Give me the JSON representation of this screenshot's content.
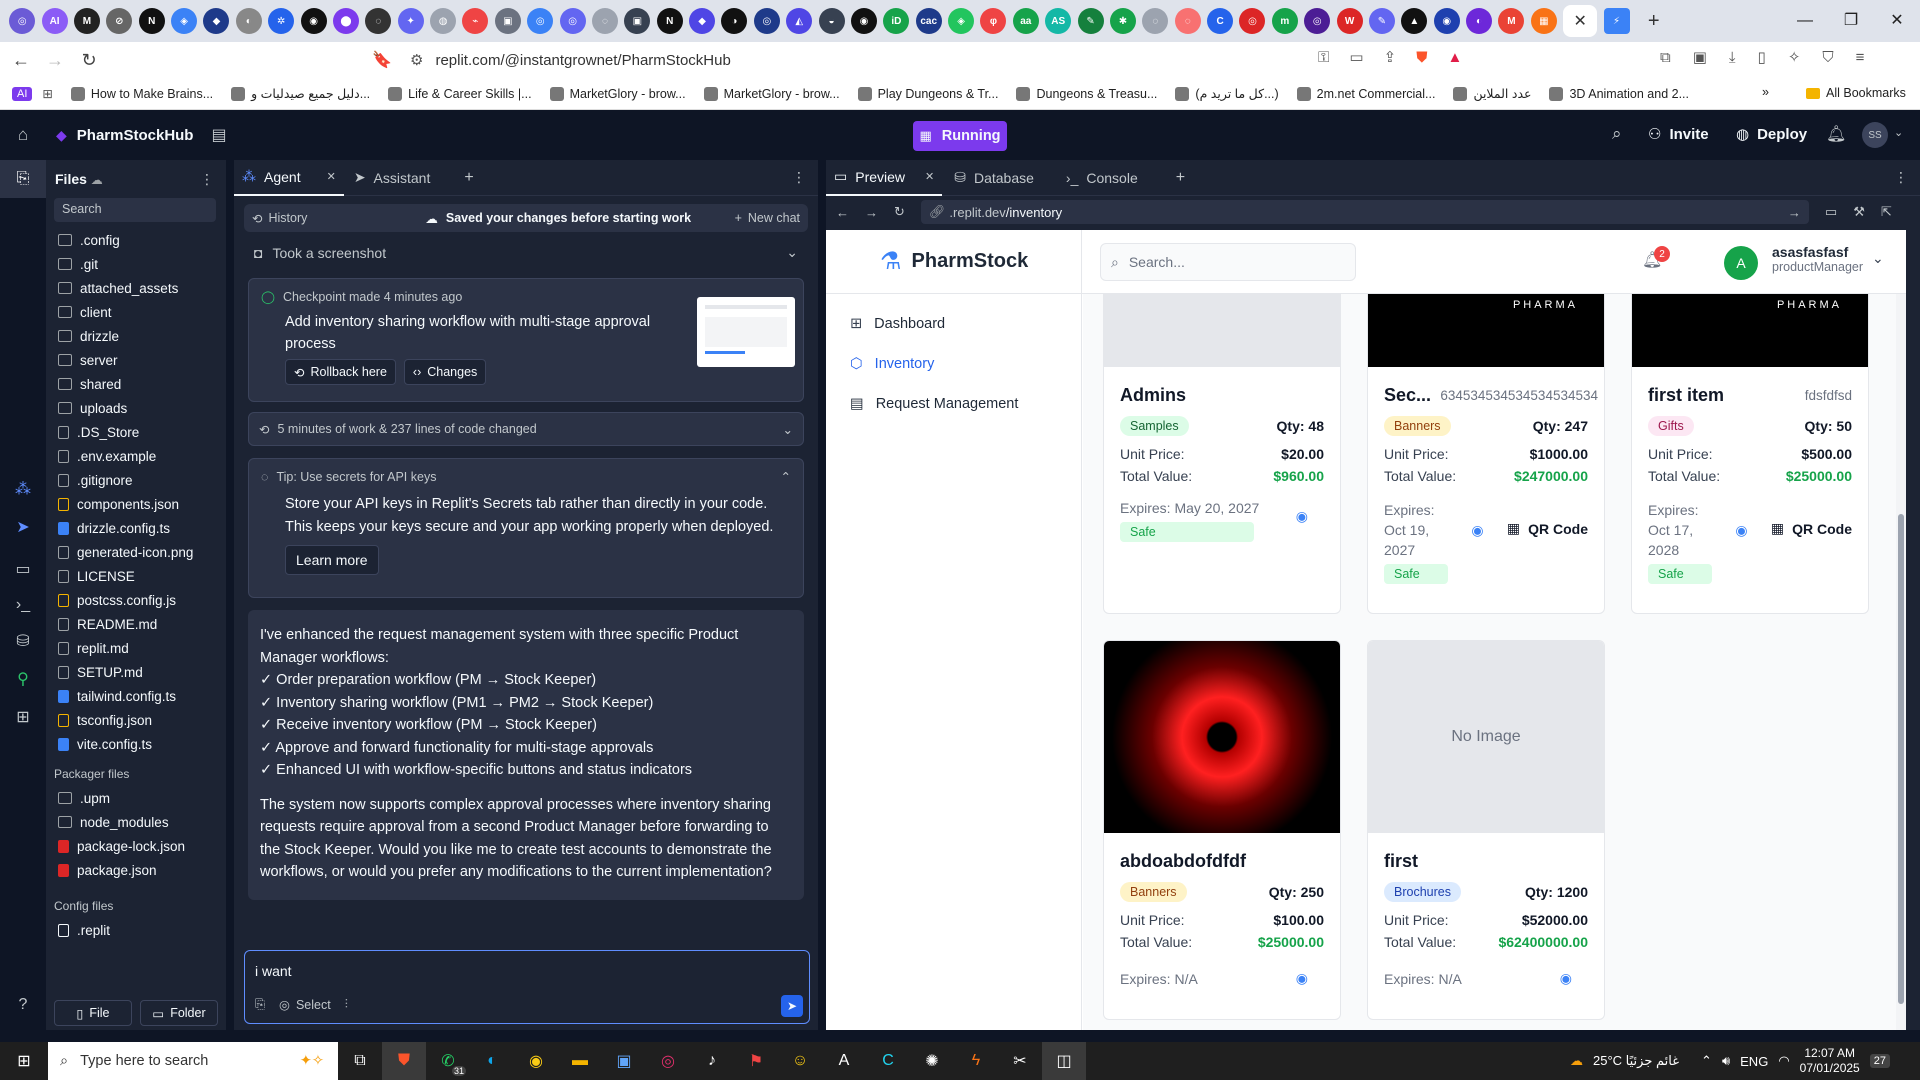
{
  "browser": {
    "favicon_tabs": [
      {
        "label": "◎",
        "color": "#6b5bd6"
      },
      {
        "label": "AI",
        "color": "#8b5cf6"
      },
      {
        "label": "M",
        "color": "#222"
      },
      {
        "label": "⊘",
        "color": "#666"
      },
      {
        "label": "N",
        "color": "#111"
      },
      {
        "label": "◈",
        "color": "#3b82f6"
      },
      {
        "label": "◆",
        "color": "#1e3a8a"
      },
      {
        "label": "◐",
        "color": "#888"
      },
      {
        "label": "✲",
        "color": "#2563eb"
      },
      {
        "label": "◉",
        "color": "#111"
      },
      {
        "label": "⬤",
        "color": "#7c3aed"
      },
      {
        "label": "◌",
        "color": "#333"
      },
      {
        "label": "✦",
        "color": "#6366f1"
      },
      {
        "label": "◍",
        "color": "#9ca3af"
      },
      {
        "label": "⌁",
        "color": "#ef4444"
      },
      {
        "label": "▣",
        "color": "#6b7280"
      },
      {
        "label": "◎",
        "color": "#3b82f6"
      },
      {
        "label": "◎",
        "color": "#6366f1"
      },
      {
        "label": "◌",
        "color": "#9ca3af"
      },
      {
        "label": "▣",
        "color": "#374151"
      },
      {
        "label": "N",
        "color": "#111"
      },
      {
        "label": "◆",
        "color": "#4f46e5"
      },
      {
        "label": "◑",
        "color": "#111"
      },
      {
        "label": "◎",
        "color": "#1e3a8a"
      },
      {
        "label": "◭",
        "color": "#4f46e5"
      },
      {
        "label": "◒",
        "color": "#374151"
      },
      {
        "label": "◉",
        "color": "#111"
      },
      {
        "label": "iD",
        "color": "#16a34a"
      },
      {
        "label": "cac",
        "color": "#1e3a8a"
      },
      {
        "label": "◈",
        "color": "#22c55e"
      },
      {
        "label": "φ",
        "color": "#ef4444"
      },
      {
        "label": "aa",
        "color": "#16a34a"
      },
      {
        "label": "AS",
        "color": "#14b8a6"
      },
      {
        "label": "✎",
        "color": "#15803d"
      },
      {
        "label": "✱",
        "color": "#16a34a"
      },
      {
        "label": "◌",
        "color": "#9ca3af"
      },
      {
        "label": "◌",
        "color": "#f87171"
      },
      {
        "label": "C",
        "color": "#2563eb"
      },
      {
        "label": "◎",
        "color": "#dc2626"
      },
      {
        "label": "m",
        "color": "#16a34a"
      },
      {
        "label": "◎",
        "color": "#4c1d95"
      },
      {
        "label": "W",
        "color": "#dc2626"
      },
      {
        "label": "✎",
        "color": "#6366f1"
      },
      {
        "label": "▲",
        "color": "#111"
      },
      {
        "label": "◉",
        "color": "#1e40af"
      },
      {
        "label": "◐",
        "color": "#6d28d9"
      },
      {
        "label": "M",
        "color": "#ea4335"
      },
      {
        "label": "▦",
        "color": "#f97316"
      }
    ],
    "active_tab_close": "✕",
    "last_tab": "⚡",
    "new_tab": "+",
    "url": "replit.com/@instantgrownet/PharmStockHub",
    "bookmarks": [
      "How to Make Brains...",
      "دليل جميع صيدليات و...",
      "Life & Career Skills |...",
      "MarketGlory - brow...",
      "MarketGlory - brow...",
      "Play Dungeons & Tr...",
      "Dungeons & Treasu...",
      "(كل ما تريد م...)",
      "2m.net Commercial...",
      "عدد الملاين",
      "3D Animation and 2..."
    ],
    "all_bookmarks": "All Bookmarks",
    "ai_label": "AI"
  },
  "replit": {
    "project_name": "PharmStockHub",
    "running": "Running",
    "invite": "Invite",
    "deploy": "Deploy",
    "avatar": "SS"
  },
  "files": {
    "title": "Files",
    "search_placeholder": "Search",
    "items": [
      {
        "name": ".config",
        "type": "folder"
      },
      {
        "name": ".git",
        "type": "folder"
      },
      {
        "name": "attached_assets",
        "type": "folder"
      },
      {
        "name": "client",
        "type": "folder"
      },
      {
        "name": "drizzle",
        "type": "folder"
      },
      {
        "name": "server",
        "type": "folder"
      },
      {
        "name": "shared",
        "type": "folder"
      },
      {
        "name": "uploads",
        "type": "folder"
      },
      {
        "name": ".DS_Store",
        "type": "file"
      },
      {
        "name": ".env.example",
        "type": "file"
      },
      {
        "name": ".gitignore",
        "type": "file"
      },
      {
        "name": "components.json",
        "type": "json"
      },
      {
        "name": "drizzle.config.ts",
        "type": "ts"
      },
      {
        "name": "generated-icon.png",
        "type": "img"
      },
      {
        "name": "LICENSE",
        "type": "file"
      },
      {
        "name": "postcss.config.js",
        "type": "js"
      },
      {
        "name": "README.md",
        "type": "md"
      },
      {
        "name": "replit.md",
        "type": "md"
      },
      {
        "name": "SETUP.md",
        "type": "md"
      },
      {
        "name": "tailwind.config.ts",
        "type": "ts"
      },
      {
        "name": "tsconfig.json",
        "type": "json"
      },
      {
        "name": "vite.config.ts",
        "type": "ts"
      }
    ],
    "packager_title": "Packager files",
    "packager": [
      {
        "name": ".upm",
        "type": "folder"
      },
      {
        "name": "node_modules",
        "type": "folder"
      },
      {
        "name": "package-lock.json",
        "type": "npm"
      },
      {
        "name": "package.json",
        "type": "npm"
      }
    ],
    "config_title": "Config files",
    "config": [
      {
        "name": ".replit",
        "type": "replit"
      }
    ],
    "new_file": "File",
    "new_folder": "Folder"
  },
  "agent": {
    "tab_agent": "Agent",
    "tab_assistant": "Assistant",
    "history": "History",
    "saved": "Saved your changes before starting work",
    "new_chat": "New chat",
    "screenshot": "Took a screenshot",
    "checkpoint_meta": "Checkpoint made 4 minutes ago",
    "checkpoint_title": "Add inventory sharing workflow with multi-stage approval process",
    "rollback": "Rollback here",
    "changes": "Changes",
    "work_summary": "5 minutes of work & 237 lines of code changed",
    "tip_title": "Tip: Use secrets for API keys",
    "tip_body": "Store your API keys in Replit's Secrets tab rather than directly in your code. This keeps your keys secure and your app working properly when deployed.",
    "learn_more": "Learn more",
    "message_intro": "I've enhanced the request management system with three specific Product Manager workflows:",
    "message_points": [
      "✓ Order preparation workflow (PM → Stock Keeper)",
      "✓ Inventory sharing workflow (PM1 → PM2 → Stock Keeper)",
      "✓ Receive inventory workflow (PM → Stock Keeper)",
      "✓ Approve and forward functionality for multi-stage approvals",
      "✓ Enhanced UI with workflow-specific buttons and status indicators"
    ],
    "message_outro": "The system now supports complex approval processes where inventory sharing requests require approval from a second Product Manager before forwarding to the Stock Keeper. Would you like me to create test accounts to demonstrate the workflows, or would you prefer any modifications to the current implementation?",
    "input_value": "i want",
    "select": "Select"
  },
  "preview": {
    "tab_preview": "Preview",
    "tab_database": "Database",
    "tab_console": "Console",
    "url_prefix": ".replit.dev",
    "url_path": "/inventory"
  },
  "app": {
    "brand": "PharmStock",
    "search_placeholder": "Search...",
    "notif_count": "2",
    "user_initial": "A",
    "user_name": "asasfasfasf",
    "user_role": "productManager",
    "nav": [
      "Dashboard",
      "Inventory",
      "Request Management"
    ],
    "pharma_text": "PHARMA",
    "cards_top": [
      {
        "name": "Admins",
        "code": "",
        "category": "Samples",
        "qty": "Qty: 48",
        "unit_label": "Unit Price:",
        "unit": "$20.00",
        "total_label": "Total Value:",
        "total": "$960.00",
        "expires": "Expires: May 20, 2027",
        "status": "Safe",
        "qr": ""
      },
      {
        "name": "Sec...",
        "code": "634534534534534534534",
        "category": "Banners",
        "qty": "Qty: 247",
        "unit_label": "Unit Price:",
        "unit": "$1000.00",
        "total_label": "Total Value:",
        "total": "$247000.00",
        "expires": "Expires: Oct 19, 2027",
        "status": "Safe",
        "qr": "QR Code"
      },
      {
        "name": "first item",
        "code": "fdsfdfsd",
        "category": "Gifts",
        "qty": "Qty: 50",
        "unit_label": "Unit Price:",
        "unit": "$500.00",
        "total_label": "Total Value:",
        "total": "$25000.00",
        "expires": "Expires: Oct 17, 2028",
        "status": "Safe",
        "qr": "QR Code"
      }
    ],
    "cards_bottom": [
      {
        "name": "abdoabdofdfdf",
        "category": "Banners",
        "qty": "Qty: 250",
        "unit_label": "Unit Price:",
        "unit": "$100.00",
        "total_label": "Total Value:",
        "total": "$25000.00",
        "expires": "Expires: N/A"
      },
      {
        "name": "first",
        "category": "Brochures",
        "qty": "Qty: 1200",
        "unit_label": "Unit Price:",
        "unit": "$52000.00",
        "total_label": "Total Value:",
        "total": "$62400000.00",
        "expires": "Expires: N/A",
        "no_image": "No Image"
      }
    ]
  },
  "taskbar": {
    "search_placeholder": "Type here to search",
    "whatsapp_badge": "31",
    "weather": "25°C غائم جزئيًا",
    "lang": "ENG",
    "time": "12:07 AM",
    "date": "07/01/2025",
    "notif_count": "27"
  },
  "colors": {
    "replit_bg": "#0e1525",
    "panel": "#1c2333",
    "card": "#2b3245",
    "accent": "#7c3aed",
    "blue": "#2563eb",
    "green": "#16a34a"
  }
}
